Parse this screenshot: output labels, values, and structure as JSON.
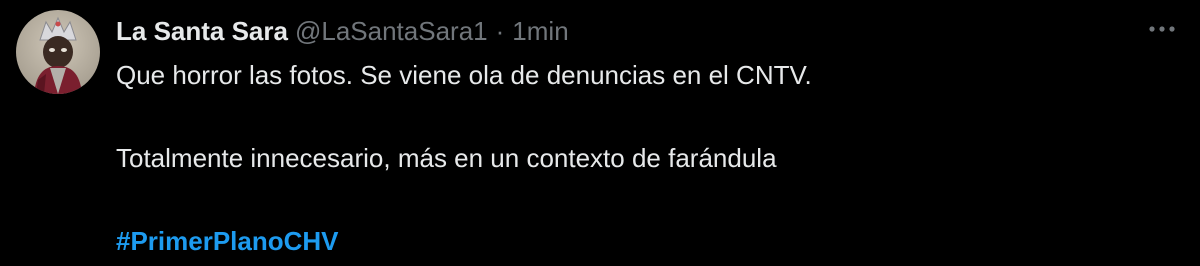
{
  "tweet": {
    "author": {
      "display_name": "La Santa Sara",
      "handle": "@LaSantaSara1",
      "avatar_icon": "profile-avatar"
    },
    "separator": "·",
    "timestamp": "1min",
    "more_icon": "more-options-icon",
    "text_lines": [
      "Que horror las fotos. Se viene ola de denuncias en el CNTV.",
      "Totalmente innecesario, más en un contexto de farándula"
    ],
    "hashtag": "#PrimerPlanoCHV"
  },
  "colors": {
    "background": "#000000",
    "primary_text": "#e7e9ea",
    "secondary_text": "#71767b",
    "link": "#1d9bf0"
  }
}
